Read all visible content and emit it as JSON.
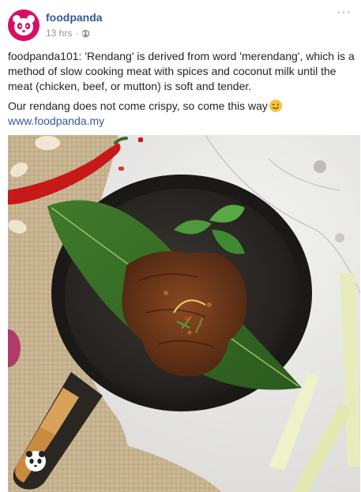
{
  "post": {
    "page_name": "foodpanda",
    "timestamp": "13 hrs",
    "options_label": "···",
    "body_line1": "foodpanda101: 'Rendang' is derived from word 'merendang', which is a method of slow cooking meat with spices and coconut milk until the meat (chicken, beef, or mutton) is soft and tender.",
    "body_line2": "Our rendang does not come crispy, so come this way",
    "link": "www.foodpanda.my"
  },
  "icons": {
    "avatar": "foodpanda-panda-logo",
    "privacy": "globe-icon",
    "emoji": "winking-face-emoji",
    "watermark": "panda-watermark-icon"
  },
  "colors": {
    "brand_pink": "#d70f64",
    "link_blue": "#365899",
    "meta_gray": "#90949c",
    "text": "#1d2129"
  }
}
